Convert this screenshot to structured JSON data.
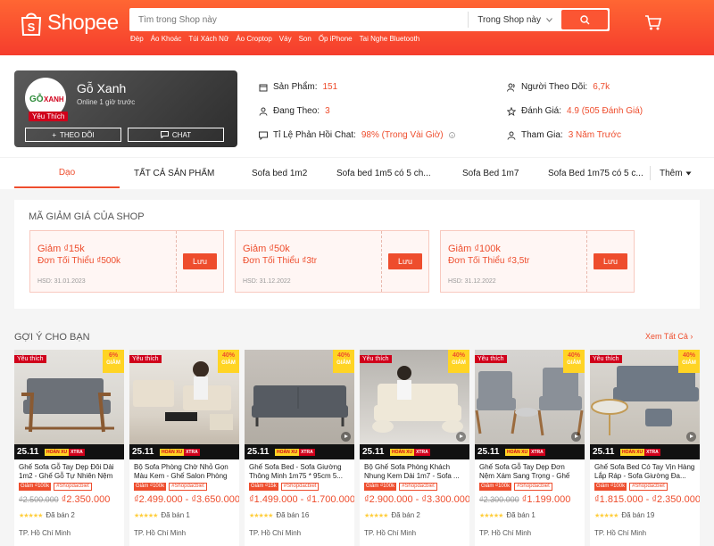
{
  "header": {
    "logo_text": "Shopee",
    "search_placeholder": "Tìm trong Shop này",
    "search_scope": "Trong Shop này",
    "keywords": [
      "Đèp",
      "Áo Khoác",
      "Túi Xách Nữ",
      "Áo Croptop",
      "Váy",
      "Son",
      "Ốp iPhone",
      "Tai Nghe Bluetooth"
    ]
  },
  "shop": {
    "name": "Gỗ Xanh",
    "online": "Online 1 giờ trước",
    "badge": "Yêu Thích",
    "logo_text_go": "GỖ",
    "logo_text_xanh": "XANH",
    "follow_label": "THEO DÕI",
    "chat_label": "CHAT",
    "stats_left": [
      {
        "icon": "store-icon",
        "label": "Sản Phẩm:",
        "value": "151"
      },
      {
        "icon": "user-icon",
        "label": "Đang Theo:",
        "value": "3"
      },
      {
        "icon": "chat-icon",
        "label": "Tỉ Lệ Phản Hồi Chat:",
        "value": "98% (Trong Vài Giờ)"
      }
    ],
    "stats_right": [
      {
        "icon": "followers-icon",
        "label": "Người Theo Dõi:",
        "value": "6,7k"
      },
      {
        "icon": "star-icon",
        "label": "Đánh Giá:",
        "value": "4.9 (505 Đánh Giá)"
      },
      {
        "icon": "joined-icon",
        "label": "Tham Gia:",
        "value": "3 Năm Trước"
      }
    ]
  },
  "tabs": [
    "Dạo",
    "TẤT CẢ SẢN PHẨM",
    "Sofa bed 1m2",
    "Sofa bed 1m5 có 5 ch...",
    "Sofa Bed 1m7",
    "Sofa Bed 1m75 có 5 c...",
    "Thêm"
  ],
  "vouchers": {
    "title": "MÃ GIẢM GIÁ CỦA SHOP",
    "items": [
      {
        "amount": "Giảm ₫15k",
        "min": "Đơn Tối Thiểu ₫500k",
        "expiry": "HSD: 31.01.2023",
        "button": "Lưu"
      },
      {
        "amount": "Giảm ₫50k",
        "min": "Đơn Tối Thiểu ₫3tr",
        "expiry": "HSD: 31.12.2022",
        "button": "Lưu"
      },
      {
        "amount": "Giảm ₫100k",
        "min": "Đơn Tối Thiểu ₫3,5tr",
        "expiry": "HSD: 31.12.2022",
        "button": "Lưu"
      }
    ]
  },
  "recommend": {
    "title": "GỢI Ý CHO BẠN",
    "see_all": "Xem Tất Cả",
    "products": [
      {
        "fav": "Yêu thích",
        "discount": "6%",
        "discount_label": "GIẢM",
        "date": "25.11",
        "name": "Ghế Sofa Gỗ Tay Dẹp Đôi Dài 1m2 - Ghế Gỗ Tự Nhiên Nệm ...",
        "tag1": "Giảm ₫100k",
        "tag2": "#Shopdacbiet",
        "price_old": "₫2.500.000",
        "price": "₫2.350.000",
        "sold": "Đã bán 2",
        "location": "TP. Hồ Chí Minh",
        "video": false
      },
      {
        "fav": "Yêu thích",
        "discount": "40%",
        "discount_label": "GIẢM",
        "date": "25.11",
        "name": "Bộ Sofa Phòng Chờ Nhỏ Gọn Màu Kem - Ghế Salon Phòng ...",
        "tag1": "Giảm ₫100k",
        "tag2": "#Shopdacbiet",
        "price_old": "",
        "price": "₫2.499.000 - ₫3.650.000",
        "sold": "Đã bán 1",
        "location": "TP. Hồ Chí Minh",
        "video": false
      },
      {
        "fav": "",
        "discount": "40%",
        "discount_label": "GIẢM",
        "date": "25.11",
        "name": "Ghế Sofa Bed - Sofa Giường Thông Minh 1m75 * 95cm 5...",
        "tag1": "Giảm ₫15k",
        "tag2": "#Shopdacbiet",
        "price_old": "",
        "price": "₫1.499.000 - ₫1.700.000",
        "sold": "Đã bán 16",
        "location": "TP. Hồ Chí Minh",
        "video": true
      },
      {
        "fav": "Yêu thích",
        "discount": "40%",
        "discount_label": "GIẢM",
        "date": "25.11",
        "name": "Bộ Ghế Sofa Phòng Khách Nhung Kem Dài 1m7 - Sofa ...",
        "tag1": "Giảm ₫100k",
        "tag2": "#Shopdacbiet",
        "price_old": "",
        "price": "₫2.900.000 - ₫3.300.000",
        "sold": "Đã bán 2",
        "location": "TP. Hồ Chí Minh",
        "video": true
      },
      {
        "fav": "Yêu thích",
        "discount": "40%",
        "discount_label": "GIẢM",
        "date": "25.11",
        "name": "Ghế Sofa Gỗ Tay Dẹp Đơn Nệm Xám Sang Trọng - Ghế Sofa 1...",
        "tag1": "Giảm ₫100k",
        "tag2": "#Shopdacbiet",
        "price_old": "₫2.300.000",
        "price": "₫1.199.000",
        "sold": "Đã bán 1",
        "location": "TP. Hồ Chí Minh",
        "video": true
      },
      {
        "fav": "Yêu thích",
        "discount": "40%",
        "discount_label": "GIẢM",
        "date": "25.11",
        "name": "Ghế Sofa Bed Có Tay Vịn Hàng Lắp Ráp - Sofa Giường Đa...",
        "tag1": "Giảm ₫100k",
        "tag2": "#Shopdacbiet",
        "price_old": "",
        "price": "₫1.815.000 - ₫2.350.000",
        "sold": "Đã bán 19",
        "location": "TP. Hồ Chí Minh",
        "video": true
      }
    ]
  },
  "colors": {
    "brand": "#ee4d2d",
    "yellow": "#ffd424",
    "fav_red": "#d0011b"
  }
}
